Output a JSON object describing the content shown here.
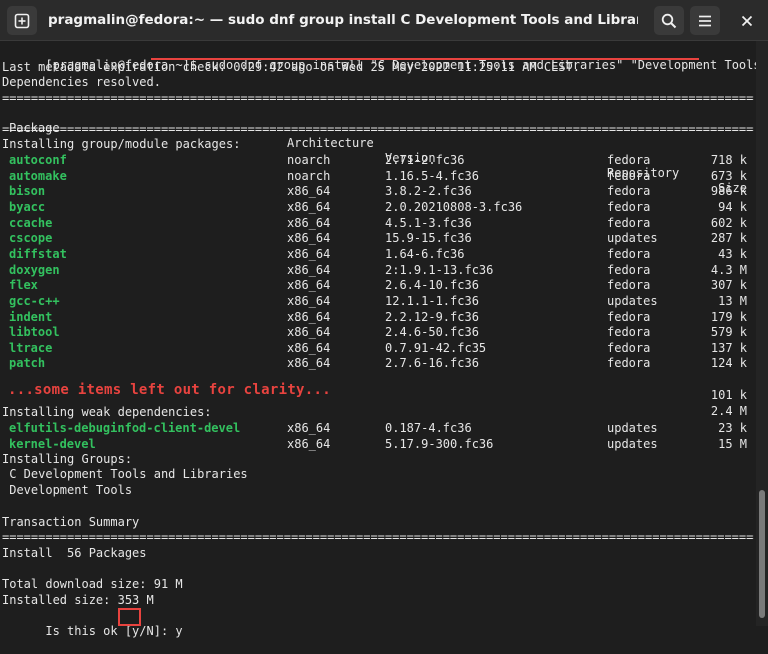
{
  "window": {
    "title": "pragmalin@fedora:~ — sudo dnf group install C Development Tools and Libraries Development …",
    "icons": {
      "new_tab": "new-tab-icon",
      "search": "search-icon",
      "menu": "hamburger-menu-icon",
      "close": "close-icon"
    }
  },
  "colors": {
    "background": "#1e1e1e",
    "text": "#e6e6e6",
    "package": "#33c15f",
    "annotation": "#e8433f"
  },
  "terminal": {
    "prompt": "[pragmalin@fedora ~]$ ",
    "command": "sudo dnf group install \"C Development Tools and Libraries\" \"Development Tools\"",
    "metadata_line": "Last metadata expiration check: 0:29:42 ago on Wed 25 May 2022 11:25:11 AM CEST.",
    "deps_resolved": "Dependencies resolved.",
    "separator": "================================================================================================================================",
    "columns": {
      "package": "Package",
      "arch": "Architecture",
      "version": "Version",
      "repo": "Repository",
      "size": "Size"
    },
    "section_group": "Installing group/module packages:",
    "packages": [
      {
        "name": "autoconf",
        "arch": "noarch",
        "version": "2.71-2.fc36",
        "repo": "fedora",
        "size": "718 k"
      },
      {
        "name": "automake",
        "arch": "noarch",
        "version": "1.16.5-4.fc36",
        "repo": "fedora",
        "size": "673 k"
      },
      {
        "name": "bison",
        "arch": "x86_64",
        "version": "3.8.2-2.fc36",
        "repo": "fedora",
        "size": "986 k"
      },
      {
        "name": "byacc",
        "arch": "x86_64",
        "version": "2.0.20210808-3.fc36",
        "repo": "fedora",
        "size": "94 k"
      },
      {
        "name": "ccache",
        "arch": "x86_64",
        "version": "4.5.1-3.fc36",
        "repo": "fedora",
        "size": "602 k"
      },
      {
        "name": "cscope",
        "arch": "x86_64",
        "version": "15.9-15.fc36",
        "repo": "updates",
        "size": "287 k"
      },
      {
        "name": "diffstat",
        "arch": "x86_64",
        "version": "1.64-6.fc36",
        "repo": "fedora",
        "size": "43 k"
      },
      {
        "name": "doxygen",
        "arch": "x86_64",
        "version": "2:1.9.1-13.fc36",
        "repo": "fedora",
        "size": "4.3 M"
      },
      {
        "name": "flex",
        "arch": "x86_64",
        "version": "2.6.4-10.fc36",
        "repo": "fedora",
        "size": "307 k"
      },
      {
        "name": "gcc-c++",
        "arch": "x86_64",
        "version": "12.1.1-1.fc36",
        "repo": "updates",
        "size": "13 M"
      },
      {
        "name": "indent",
        "arch": "x86_64",
        "version": "2.2.12-9.fc36",
        "repo": "fedora",
        "size": "179 k"
      },
      {
        "name": "libtool",
        "arch": "x86_64",
        "version": "2.4.6-50.fc36",
        "repo": "fedora",
        "size": "579 k"
      },
      {
        "name": "ltrace",
        "arch": "x86_64",
        "version": "0.7.91-42.fc35",
        "repo": "fedora",
        "size": "137 k"
      },
      {
        "name": "patch",
        "arch": "x86_64",
        "version": "2.7.6-16.fc36",
        "repo": "fedora",
        "size": "124 k"
      }
    ],
    "left_out_note": "...some items left out for clarity...",
    "left_out_sizes": [
      "101 k",
      "2.4 M"
    ],
    "section_weak": "Installing weak dependencies:",
    "weak_packages": [
      {
        "name": "elfutils-debuginfod-client-devel",
        "arch": "x86_64",
        "version": "0.187-4.fc36",
        "repo": "updates",
        "size": "23 k"
      },
      {
        "name": "kernel-devel",
        "arch": "x86_64",
        "version": "5.17.9-300.fc36",
        "repo": "updates",
        "size": "15 M"
      }
    ],
    "section_groups": "Installing Groups:",
    "groups": [
      " C Development Tools and Libraries",
      " Development Tools"
    ],
    "summary_title": "Transaction Summary",
    "install_line": "Install  56 Packages",
    "download_size": "Total download size: 91 M",
    "installed_size": "Installed size: 353 M",
    "confirm_prompt": "Is this ok [y/N]: ",
    "confirm_answer": "y"
  }
}
